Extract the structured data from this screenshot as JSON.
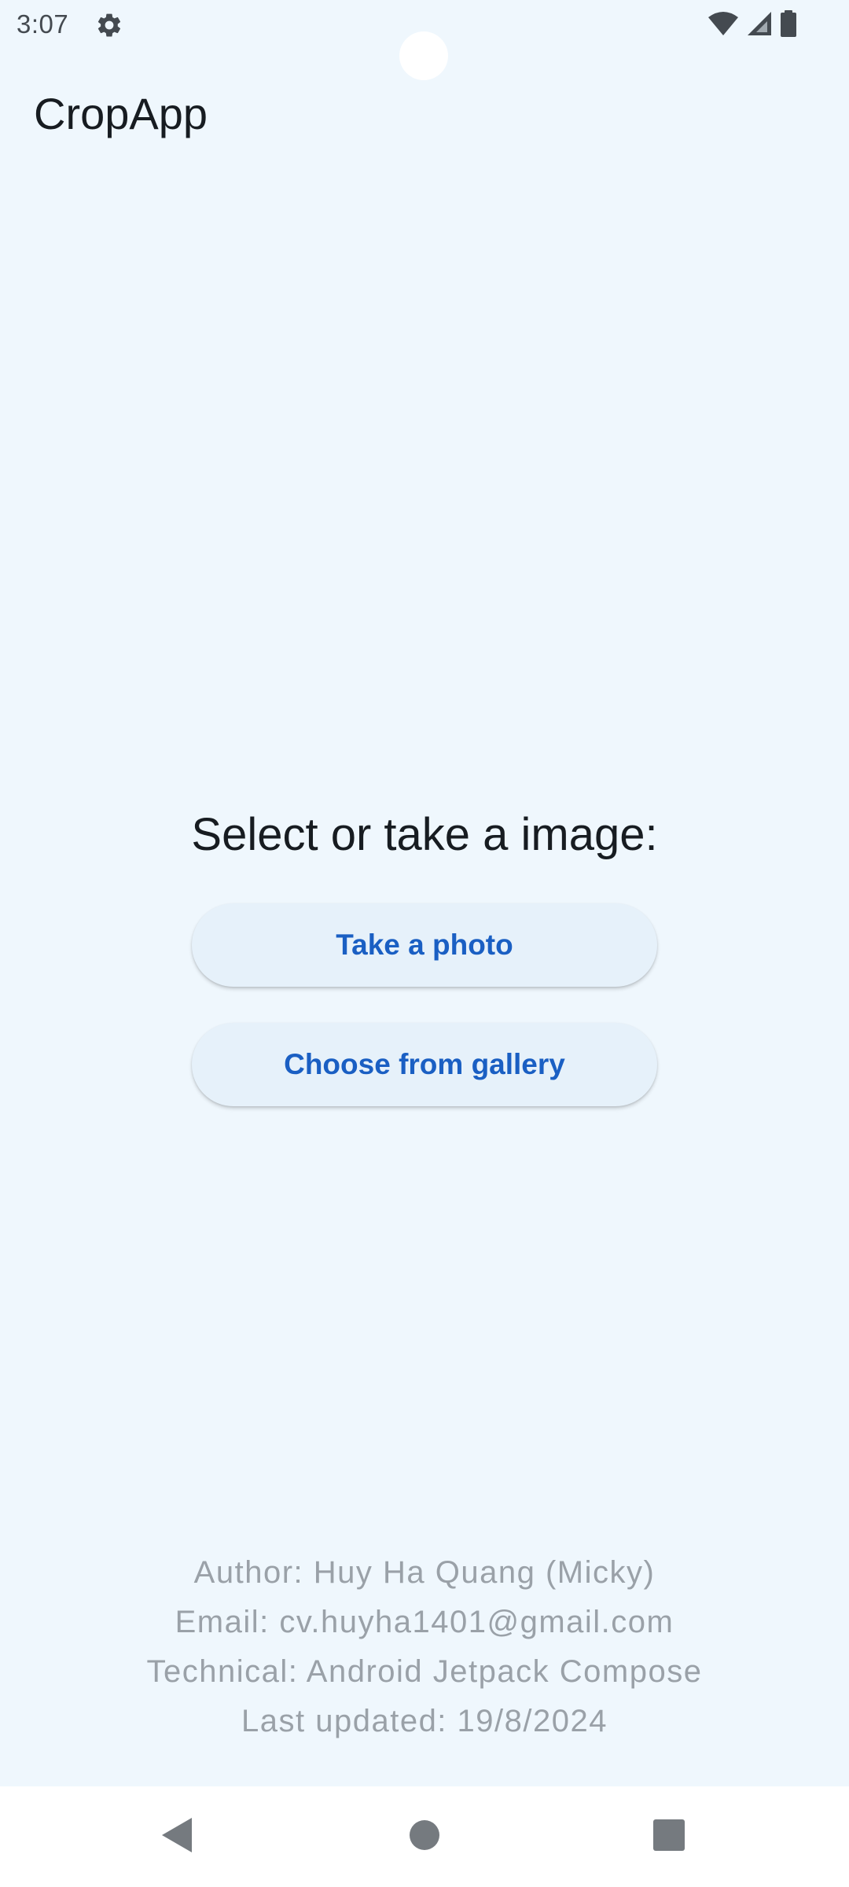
{
  "status_bar": {
    "time": "3:07",
    "icons": [
      "gear-icon",
      "wifi-icon",
      "signal-icon",
      "battery-icon"
    ]
  },
  "app_bar": {
    "title": "CropApp"
  },
  "main": {
    "prompt": "Select or take a image:",
    "take_photo_label": "Take a photo",
    "gallery_label": "Choose from gallery"
  },
  "footer": {
    "author": "Author: Huy Ha Quang (Micky)",
    "email": "Email: cv.huyha1401@gmail.com",
    "technical": "Technical: Android Jetpack Compose",
    "last_updated": "Last updated: 19/8/2024"
  },
  "nav_bar": {
    "icons": [
      "back-icon",
      "home-icon",
      "recents-icon"
    ]
  },
  "colors": {
    "background": "#eff7fd",
    "button_bg": "#e6f1fa",
    "button_text": "#1a5fc3",
    "footer_text": "#9aa1a8"
  }
}
